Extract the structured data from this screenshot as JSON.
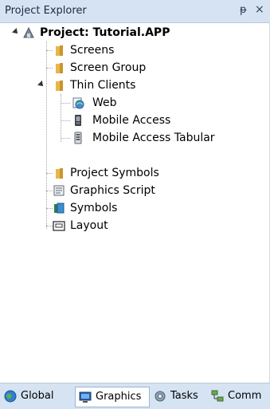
{
  "panel": {
    "title": "Project Explorer",
    "pin_glyph": "ɹ",
    "close_glyph": "×"
  },
  "tree": {
    "root_label": "Project: Tutorial.APP",
    "screens": "Screens",
    "screen_group": "Screen Group",
    "thin_clients": "Thin Clients",
    "web": "Web",
    "mobile_access": "Mobile Access",
    "mobile_access_tabular": "Mobile Access Tabular",
    "project_symbols": "Project Symbols",
    "graphics_script": "Graphics Script",
    "symbols": "Symbols",
    "layout": "Layout"
  },
  "tabs": {
    "global": "Global",
    "graphics": "Graphics",
    "tasks": "Tasks",
    "comm": "Comm",
    "active": "Graphics"
  },
  "colors": {
    "folder": "#e8b64a",
    "header_bg": "#d6e3f2",
    "tab_active_bg": "#ffffff"
  }
}
